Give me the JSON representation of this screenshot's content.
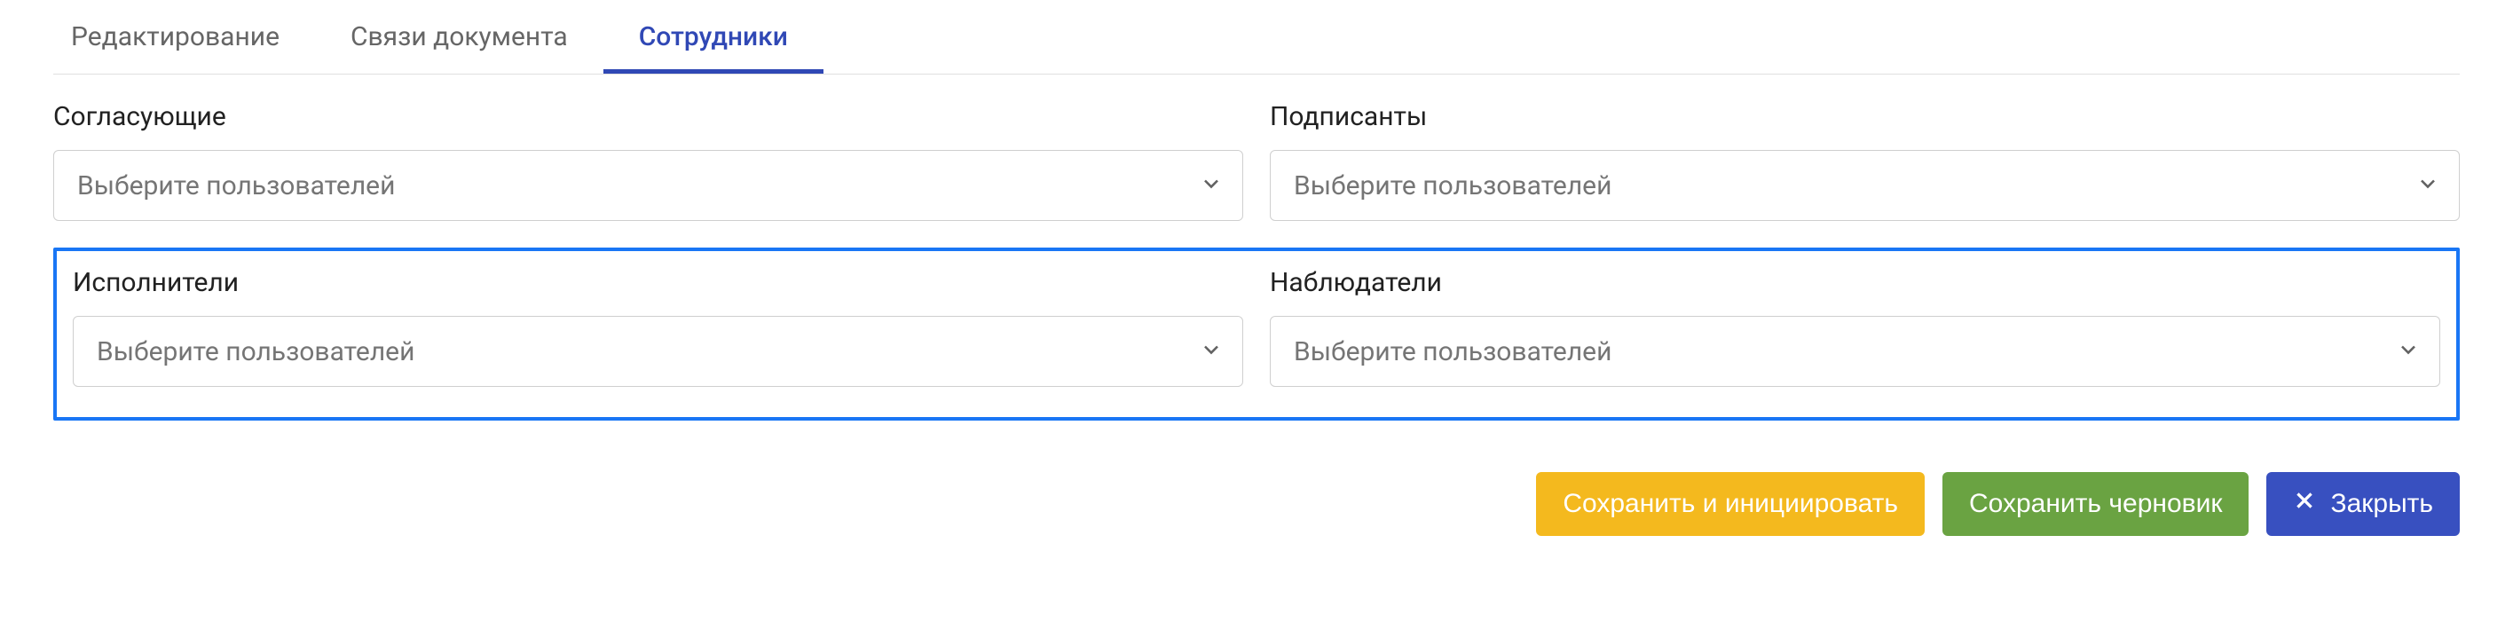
{
  "tabs": [
    {
      "label": "Редактирование",
      "active": false
    },
    {
      "label": "Связи документа",
      "active": false
    },
    {
      "label": "Сотрудники",
      "active": true
    }
  ],
  "fields": {
    "approvers": {
      "label": "Согласующие",
      "placeholder": "Выберите пользователей"
    },
    "signers": {
      "label": "Подписанты",
      "placeholder": "Выберите пользователей"
    },
    "executors": {
      "label": "Исполнители",
      "placeholder": "Выберите пользователей"
    },
    "observers": {
      "label": "Наблюдатели",
      "placeholder": "Выберите пользователей"
    }
  },
  "actions": {
    "save_initiate": "Сохранить и инициировать",
    "save_draft": "Сохранить черновик",
    "close": "Закрыть"
  }
}
